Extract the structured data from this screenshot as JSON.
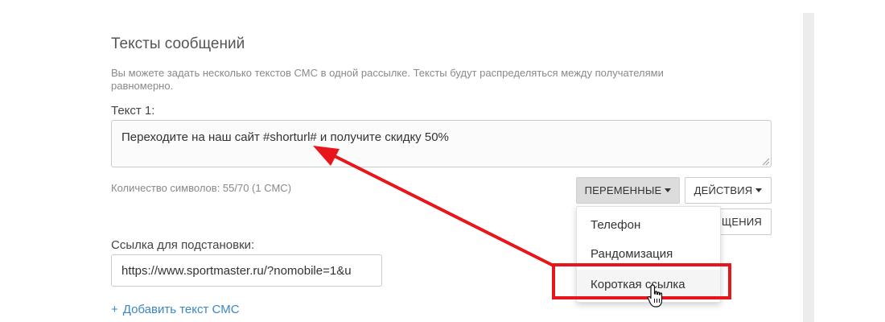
{
  "section": {
    "title": "Тексты сообщений",
    "description": "Вы можете задать несколько текстов СМС в одной рассылке. Тексты будут распределяться между получателями равномерно."
  },
  "text1": {
    "label": "Текст 1:",
    "value": "Переходите на наш сайт #shorturl# и получите скидку 50%",
    "counter": "Количество символов: 55/70 (1 СМС)"
  },
  "toolbar": {
    "variables_label": "ПЕРЕМЕННЫЕ",
    "actions_label": "ДЕЙСТВИЯ",
    "messages_label": "ОБЩЕНИЯ"
  },
  "variables_menu": {
    "items": [
      "Телефон",
      "Рандомизация",
      "Короткая ссылка"
    ]
  },
  "link_field": {
    "label": "Ссылка для подстановки:",
    "value": "https://www.sportmaster.ru/?nomobile=1&u"
  },
  "add_text": {
    "plus": "+",
    "label": "Добавить текст СМС"
  },
  "colors": {
    "annotation_red": "#e8151b",
    "link_blue": "#3a86c8"
  }
}
